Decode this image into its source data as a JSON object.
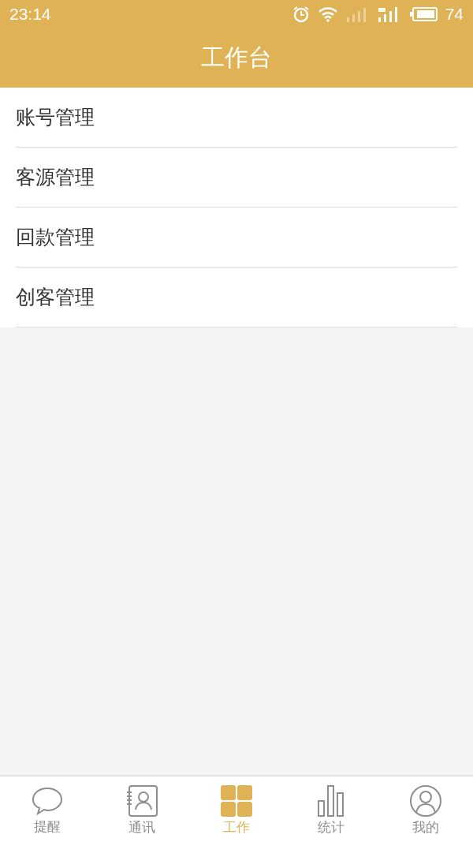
{
  "status_bar": {
    "time": "23:14",
    "battery": "74"
  },
  "header": {
    "title": "工作台"
  },
  "menu_items": [
    {
      "label": "账号管理"
    },
    {
      "label": "客源管理"
    },
    {
      "label": "回款管理"
    },
    {
      "label": "创客管理"
    }
  ],
  "tab_bar": [
    {
      "kind": "chat",
      "label": "提醒",
      "selected": false
    },
    {
      "kind": "contacts",
      "label": "通讯",
      "selected": false
    },
    {
      "kind": "grid",
      "label": "工作",
      "selected": true
    },
    {
      "kind": "stats",
      "label": "统计",
      "selected": false
    },
    {
      "kind": "profile",
      "label": "我的",
      "selected": false
    }
  ]
}
